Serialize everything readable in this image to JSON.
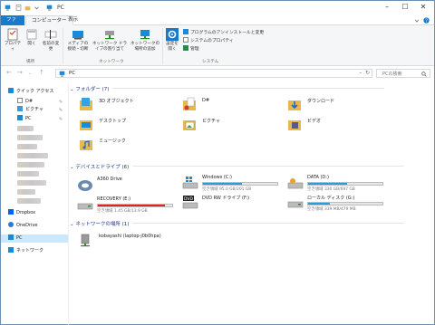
{
  "window": {
    "title": "PC"
  },
  "tabs": [
    {
      "label": "ファイル"
    },
    {
      "label": "コンピューター"
    },
    {
      "label": "表示"
    }
  ],
  "ribbon": {
    "buttons": [
      {
        "label": "プロパティ"
      },
      {
        "label": "開く"
      },
      {
        "label": "名前の変更"
      },
      {
        "label": "メディアの接続・切断"
      },
      {
        "label": "ネットワーク ドライブの割り当て"
      },
      {
        "label": "ネットワークの場所の追加"
      },
      {
        "label": "設定を開く"
      }
    ],
    "small_items": [
      {
        "label": "プログラムのアンインストールと変更"
      },
      {
        "label": "システムのプロパティ"
      },
      {
        "label": "管理"
      }
    ],
    "groups": [
      {
        "label": "場所"
      },
      {
        "label": "ネットワーク"
      },
      {
        "label": "システム"
      }
    ]
  },
  "address": {
    "path": "PC",
    "search_placeholder": "PCの検索"
  },
  "sidebar": {
    "items": [
      {
        "label": "クイック アクセス"
      },
      {
        "label": "D#"
      },
      {
        "label": "ピクチャ"
      },
      {
        "label": "PC"
      },
      {
        "label": "Dropbox"
      },
      {
        "label": "OneDrive"
      },
      {
        "label": "PC"
      },
      {
        "label": "ネットワーク"
      }
    ]
  },
  "sections": {
    "folders": "フォルダー (7)",
    "drives": "デバイスとドライブ (6)",
    "network": "ネットワークの場所 (1)"
  },
  "folders": [
    {
      "label": "3D オブジェクト"
    },
    {
      "label": "D#"
    },
    {
      "label": "ダウンロード"
    },
    {
      "label": "デスクトップ"
    },
    {
      "label": "ピクチャ"
    },
    {
      "label": "ビデオ"
    },
    {
      "label": "ミュージック"
    }
  ],
  "drives": [
    {
      "name": "A360 Drive",
      "space": "",
      "used_fraction": null
    },
    {
      "name": "Windows (C:)",
      "space": "空き領域 95.0 GB/201 GB",
      "used_fraction": 0.53
    },
    {
      "name": "DATA (D:)",
      "space": "空き領域 330 GB/697 GB",
      "used_fraction": 0.53
    },
    {
      "name": "RECOVERY (E:)",
      "space": "空き領域 1.45 GB/13.9 GB",
      "used_fraction": 0.9
    },
    {
      "name": "DVD RW ドライブ (F:)",
      "space": "",
      "used_fraction": null
    },
    {
      "name": "ローカル ディスク (G:)",
      "space": "空き領域 339 MB/479 MB",
      "used_fraction": 0.29
    }
  ],
  "network_places": [
    {
      "label": "kobayashi (laptop-j0b0hpa)"
    }
  ],
  "colors": {
    "accent": "#1979ca",
    "bar_fill": "#26a0da",
    "folder": "#e8b84a",
    "section": "#1e3287"
  }
}
